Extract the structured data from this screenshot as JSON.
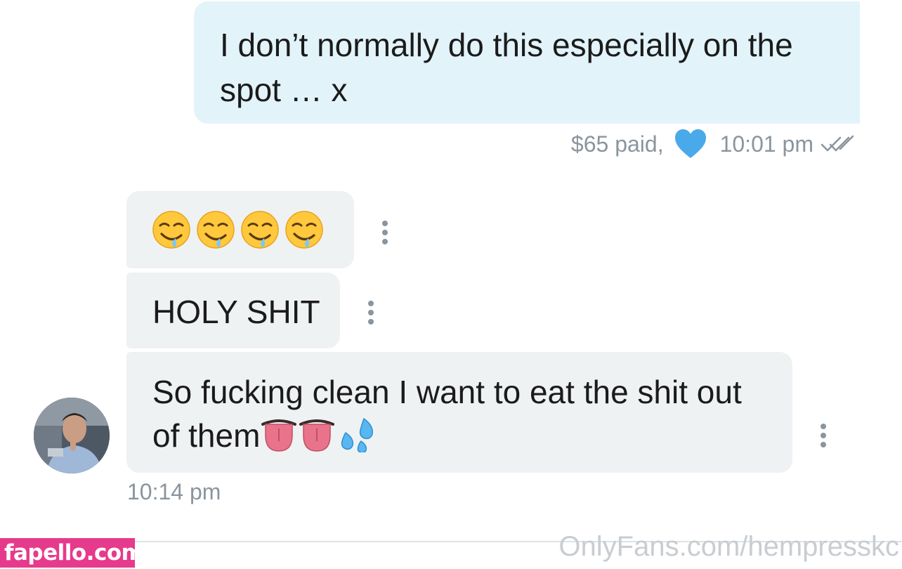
{
  "outgoing": {
    "text": "I don’t normally do this especially on the spot … x",
    "paid": "$65 paid,",
    "time": "10:01 pm",
    "heart_color": "#4aa9e9"
  },
  "incoming": {
    "msg1_emojis": [
      "drooling-face",
      "drooling-face",
      "drooling-face",
      "drooling-face"
    ],
    "msg2_text": "HOLY SHIT",
    "msg3_text": "So fucking clean I want to eat the shit out of them",
    "msg3_emojis": [
      "tongue",
      "tongue",
      "sweat-droplets"
    ],
    "time": "10:14 pm"
  },
  "watermarks": {
    "left": "fapello.com",
    "right": "OnlyFans.com/hempresskc"
  },
  "colors": {
    "outgoing_bubble": "#e2f3fa",
    "incoming_bubble": "#eff2f3",
    "meta_text": "#8a959e",
    "brand_pink": "#e63a8c"
  }
}
